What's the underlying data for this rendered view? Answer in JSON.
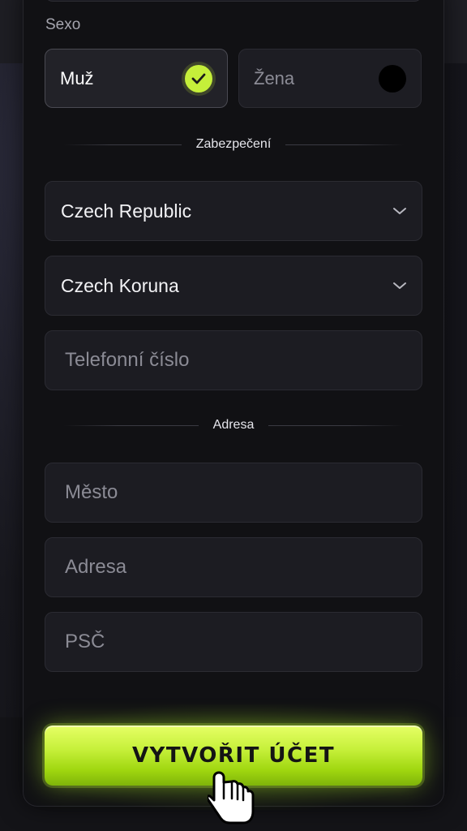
{
  "gender": {
    "label": "Sexo",
    "options": [
      {
        "label": "Muž",
        "selected": true
      },
      {
        "label": "Žena",
        "selected": false
      }
    ]
  },
  "sections": {
    "security": "Zabezpečení",
    "address": "Adresa"
  },
  "fields": {
    "country": {
      "value": "Czech Republic"
    },
    "currency": {
      "value": "Czech Koruna"
    },
    "phone": {
      "placeholder": "Telefonní číslo"
    },
    "city": {
      "placeholder": "Město"
    },
    "address": {
      "placeholder": "Adresa"
    },
    "zip": {
      "placeholder": "PSČ"
    }
  },
  "cta": {
    "label": "VYTVOŘIT ÚČET"
  },
  "colors": {
    "accent": "#c5ef3a",
    "panel": "#111114",
    "field": "#1c1c22"
  }
}
